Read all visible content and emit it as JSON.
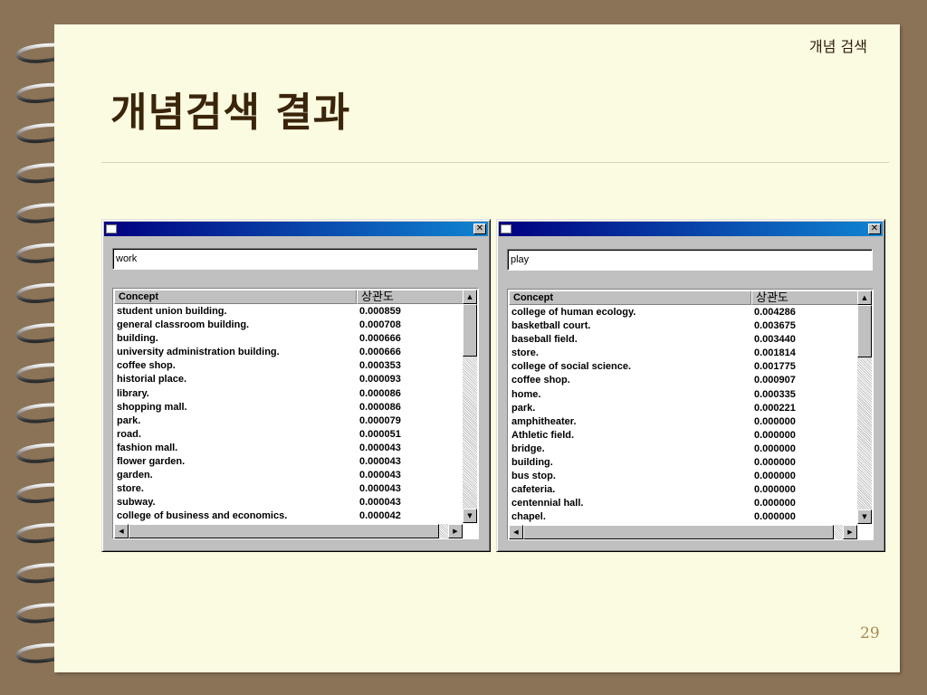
{
  "slide": {
    "header": "개념 검색",
    "title": "개념검색 결과",
    "page_number": "29"
  },
  "windows": [
    {
      "query": "work",
      "columns": {
        "concept": "Concept",
        "score": "상관도"
      },
      "rows": [
        {
          "concept": "student union building.",
          "score": "0.000859"
        },
        {
          "concept": "general classroom building.",
          "score": "0.000708"
        },
        {
          "concept": "building.",
          "score": "0.000666"
        },
        {
          "concept": "university administration building.",
          "score": "0.000666"
        },
        {
          "concept": "coffee shop.",
          "score": "0.000353"
        },
        {
          "concept": "historial place.",
          "score": "0.000093"
        },
        {
          "concept": "library.",
          "score": "0.000086"
        },
        {
          "concept": "shopping mall.",
          "score": "0.000086"
        },
        {
          "concept": "park.",
          "score": "0.000079"
        },
        {
          "concept": "road.",
          "score": "0.000051"
        },
        {
          "concept": "fashion mall.",
          "score": "0.000043"
        },
        {
          "concept": "flower garden.",
          "score": "0.000043"
        },
        {
          "concept": "garden.",
          "score": "0.000043"
        },
        {
          "concept": "store.",
          "score": "0.000043"
        },
        {
          "concept": "subway.",
          "score": "0.000043"
        },
        {
          "concept": "college of business and economics.",
          "score": "0.000042"
        }
      ]
    },
    {
      "query": "play",
      "columns": {
        "concept": "Concept",
        "score": "상관도"
      },
      "rows": [
        {
          "concept": "college of human ecology.",
          "score": "0.004286"
        },
        {
          "concept": "basketball court.",
          "score": "0.003675"
        },
        {
          "concept": "baseball field.",
          "score": "0.003440"
        },
        {
          "concept": "store.",
          "score": "0.001814"
        },
        {
          "concept": "college of social science.",
          "score": "0.001775"
        },
        {
          "concept": "coffee shop.",
          "score": "0.000907"
        },
        {
          "concept": "home.",
          "score": "0.000335"
        },
        {
          "concept": "park.",
          "score": "0.000221"
        },
        {
          "concept": "amphitheater.",
          "score": "0.000000"
        },
        {
          "concept": "Athletic field.",
          "score": "0.000000"
        },
        {
          "concept": "bridge.",
          "score": "0.000000"
        },
        {
          "concept": "building.",
          "score": "0.000000"
        },
        {
          "concept": "bus stop.",
          "score": "0.000000"
        },
        {
          "concept": "cafeteria.",
          "score": "0.000000"
        },
        {
          "concept": "centennial hall.",
          "score": "0.000000"
        },
        {
          "concept": "chapel.",
          "score": "0.000000"
        }
      ]
    }
  ],
  "icons": {
    "close": "close-icon",
    "scroll_up": "arrow-up-icon",
    "scroll_down": "arrow-down-icon",
    "scroll_left": "arrow-left-icon",
    "scroll_right": "arrow-right-icon"
  },
  "colors": {
    "background": "#8b7358",
    "page": "#fbfbe1",
    "title": "#3a240a",
    "titlebar_start": "#000080",
    "titlebar_end": "#1084d0",
    "page_number": "#a88a5a"
  }
}
